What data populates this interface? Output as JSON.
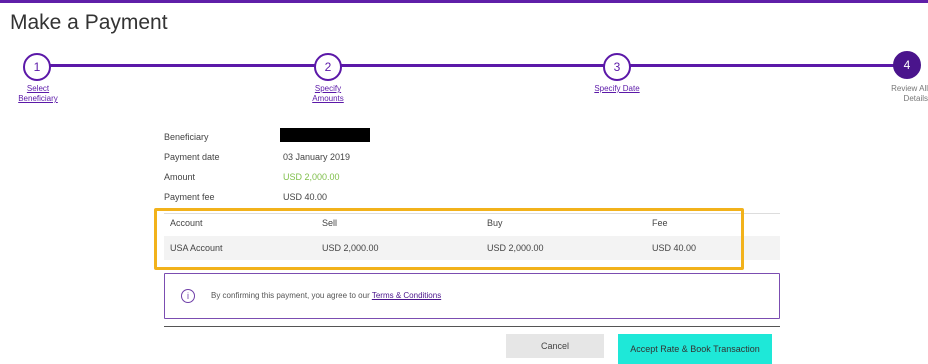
{
  "page": {
    "title": "Make a Payment"
  },
  "stepper": {
    "steps": [
      {
        "number": "1",
        "label_line1": "Select",
        "label_line2": "Beneficiary"
      },
      {
        "number": "2",
        "label_line1": "Specify",
        "label_line2": "Amounts"
      },
      {
        "number": "3",
        "label_line1": "Specify Date",
        "label_line2": ""
      },
      {
        "number": "4",
        "label_line1": "Review All",
        "label_line2": "Details"
      }
    ]
  },
  "summary": {
    "beneficiary_label": "Beneficiary",
    "payment_date_label": "Payment date",
    "payment_date_value": "03 January 2019",
    "amount_label": "Amount",
    "amount_value": "USD 2,000.00",
    "fee_label": "Payment fee",
    "fee_value": "USD 40.00"
  },
  "table": {
    "headers": [
      "Account",
      "Sell",
      "Buy",
      "Fee"
    ],
    "rows": [
      [
        "USA Account",
        "USD 2,000.00",
        "USD 2,000.00",
        "USD 40.00"
      ]
    ]
  },
  "terms": {
    "text": "By confirming this payment, you agree to our ",
    "link": "Terms & Conditions"
  },
  "buttons": {
    "cancel": "Cancel",
    "accept": "Accept Rate & Book Transaction"
  },
  "colors": {
    "brand": "#5b18a8",
    "highlight": "#f2b21b",
    "accept": "#1ee8d8",
    "amount_green": "#7fbf4a"
  },
  "icons": {
    "info": "info-icon"
  }
}
